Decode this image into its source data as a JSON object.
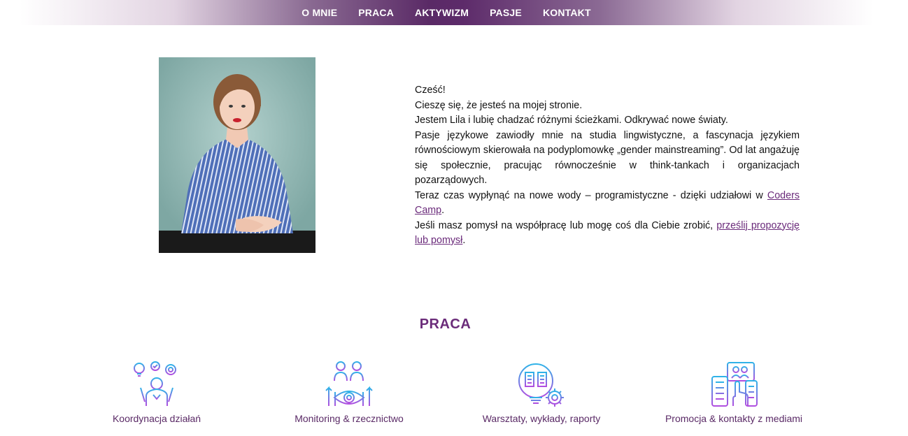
{
  "nav": {
    "items": [
      {
        "label": "O MNIE"
      },
      {
        "label": "PRACA"
      },
      {
        "label": "AKTYWIZM"
      },
      {
        "label": "PASJE"
      },
      {
        "label": "KONTAKT"
      }
    ]
  },
  "intro": {
    "greeting": "Cześć!",
    "line1": "Cieszę się, że jesteś na mojej stronie.",
    "line2": "Jestem Lila i lubię chadzać różnymi ścieżkami. Odkrywać nowe światy.",
    "line3": "Pasje językowe zawiodły mnie na studia lingwistyczne, a fascynacja językiem równościowym skierowała na podyplomowkę „gender mainstreaming”. Od lat angażuję się społecznie, pracując równocześnie w think-tankach i organizacjach pozarządowych.",
    "line4_before": "Teraz czas wypłynąć na nowe wody – programistyczne - dzięki udziałowi w",
    "line4_link": "Coders Camp",
    "line4_after": ".",
    "line5_before": "Jeśli masz pomysł na współpracę lub mogę coś dla Ciebie zrobić,",
    "line5_link": "prześlij propozycję lub pomysł",
    "line5_after": "."
  },
  "work": {
    "title": "PRACA",
    "cards": [
      {
        "label": "Koordynacja działań",
        "icon": "coordination-icon"
      },
      {
        "label": "Monitoring & rzecznictwo",
        "icon": "monitoring-icon"
      },
      {
        "label": "Warsztaty, wykłady, raporty",
        "icon": "workshops-icon"
      },
      {
        "label": "Promocja & kontakty z mediami",
        "icon": "media-icon"
      }
    ]
  },
  "colors": {
    "accent": "#6b2c7a",
    "nav_center": "#5a2a66",
    "icon_gradient_start": "#2fb3e8",
    "icon_gradient_end": "#b14ee0",
    "photo_background": "#8db6b1"
  }
}
